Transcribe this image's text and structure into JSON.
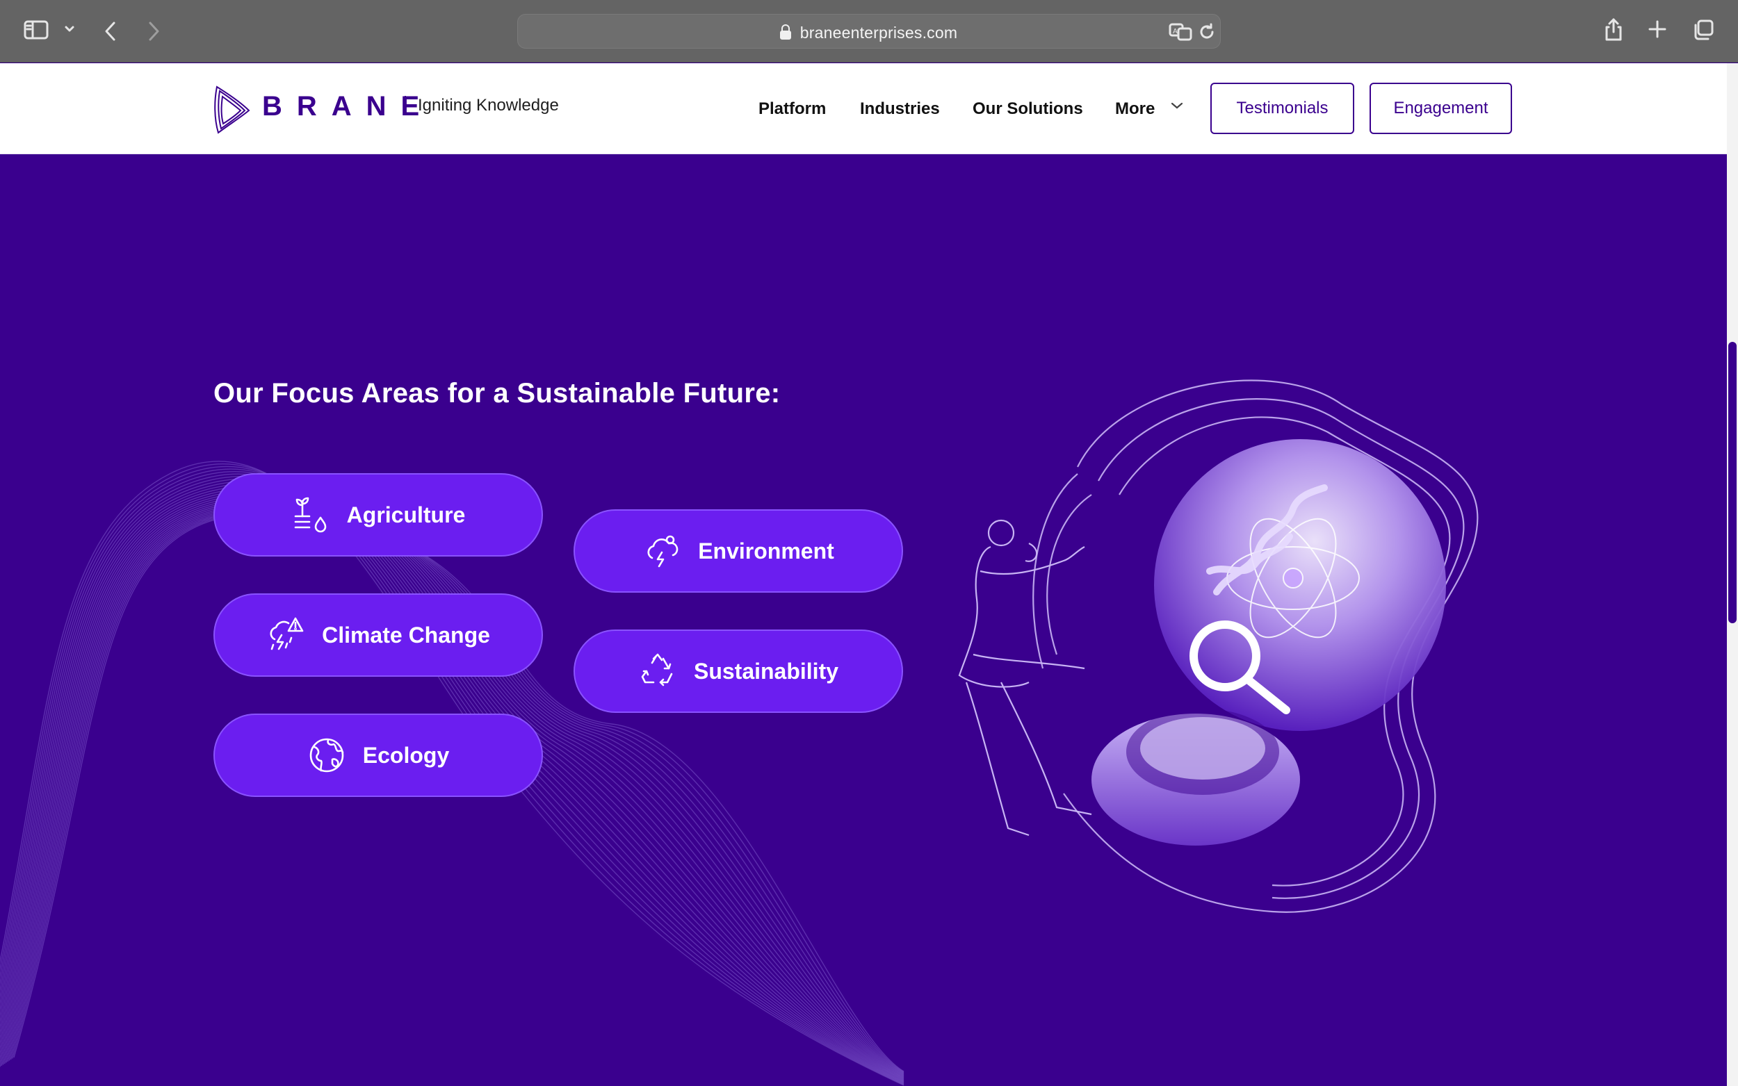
{
  "browser": {
    "url": "braneenterprises.com"
  },
  "header": {
    "logo_text": "BRANE",
    "tagline": "Igniting Knowledge",
    "nav": {
      "platform": "Platform",
      "industries": "Industries",
      "solutions": "Our Solutions",
      "more": "More"
    },
    "buttons": {
      "testimonials": "Testimonials",
      "engagement": "Engagement"
    }
  },
  "hero": {
    "heading": "Our Focus Areas for a Sustainable Future:",
    "focus_areas": [
      {
        "label": "Agriculture",
        "icon": "plant-water-icon"
      },
      {
        "label": "Environment",
        "icon": "cloud-storm-icon"
      },
      {
        "label": "Climate Change",
        "icon": "storm-warning-icon"
      },
      {
        "label": "Sustainability",
        "icon": "recycle-icon"
      },
      {
        "label": "Ecology",
        "icon": "globe-icon"
      }
    ]
  },
  "colors": {
    "brand": "#3a008e",
    "pill": "#6b1ef0",
    "pill_border": "#8a52ff",
    "chrome": "#646464"
  }
}
